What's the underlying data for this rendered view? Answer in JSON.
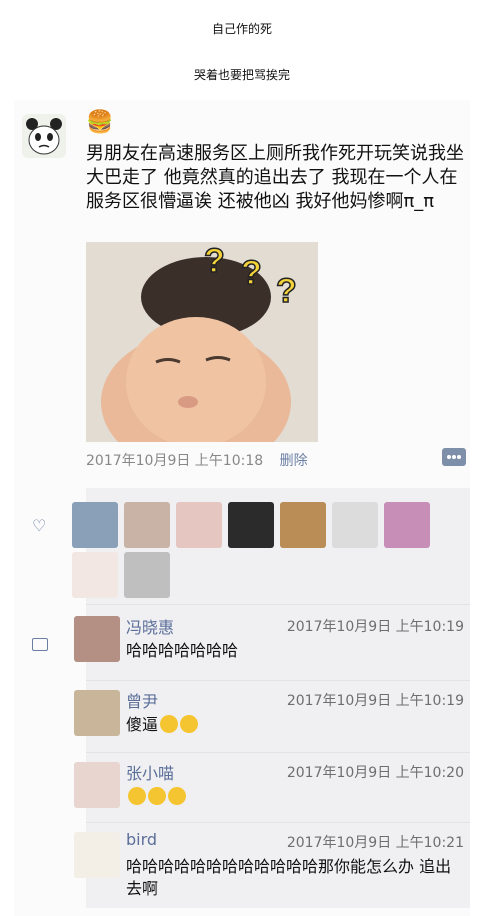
{
  "captions": {
    "title": "自己作的死",
    "subtitle": "哭着也要把骂挨完"
  },
  "post": {
    "emoji": "🍔",
    "text": "男朋友在高速服务区上厕所我作死开玩笑说我坐大巴走了 他竟然真的追出去了 我现在一个人在服务区很懵逼诶 还被他凶 我好他妈惨啊π_π",
    "timestamp": "2017年10月9日 上午10:18",
    "delete_label": "删除"
  },
  "likes": {
    "avatars": [
      "avatar-1",
      "avatar-2",
      "avatar-3",
      "avatar-4",
      "avatar-5",
      "avatar-6",
      "avatar-7",
      "avatar-8",
      "avatar-9"
    ]
  },
  "comments": [
    {
      "name": "冯晓惠",
      "time": "2017年10月9日 上午10:19",
      "text": "哈哈哈哈哈哈哈"
    },
    {
      "name": "曾尹",
      "time": "2017年10月9日 上午10:19",
      "text": "傻逼"
    },
    {
      "name": "张小喵",
      "time": "2017年10月9日 上午10:20",
      "text": ""
    },
    {
      "name": "bird",
      "time": "2017年10月9日 上午10:21",
      "text": "哈哈哈哈哈哈哈哈哈哈哈哈那你能怎么办 追出去啊"
    }
  ],
  "colors": {
    "link": "#6b7fa3",
    "panel": "#f0f0f3",
    "emoji": "#f4c531"
  }
}
